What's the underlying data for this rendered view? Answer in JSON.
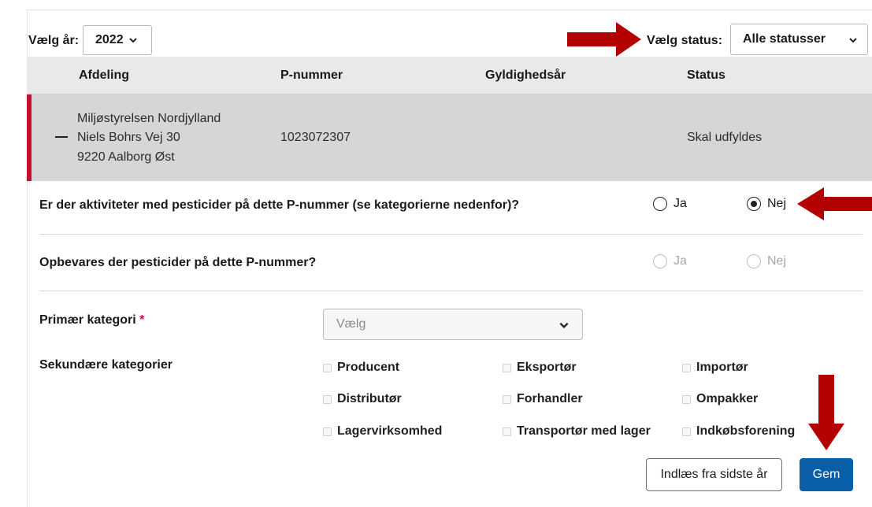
{
  "filters": {
    "year_label": "Vælg år:",
    "year_value": "2022",
    "status_label": "Vælg status:",
    "status_value": "Alle statusser"
  },
  "table": {
    "headers": [
      "Afdeling",
      "P-nummer",
      "Gyldighedsår",
      "Status"
    ],
    "row": {
      "dept_line1": "Miljøstyrelsen Nordjylland",
      "dept_line2": "Niels Bohrs Vej 30",
      "dept_line3": "9220 Aalborg Øst",
      "p_number": "1023072307",
      "validity_year": "",
      "status": "Skal udfyldes"
    }
  },
  "form": {
    "q1": {
      "text": "Er der aktiviteter med pesticider på dette P-nummer (se kategorierne nedenfor)?",
      "yes": "Ja",
      "no": "Nej",
      "selected": "Nej"
    },
    "q2": {
      "text": "Opbevares der pesticider på dette P-nummer?",
      "yes": "Ja",
      "no": "Nej",
      "disabled": true
    },
    "primary_label": "Primær kategori",
    "required_mark": "*",
    "primary_placeholder": "Vælg",
    "secondary_label": "Sekundære kategorier",
    "secondary_options": [
      "Producent",
      "Eksportør",
      "Importør",
      "Distributør",
      "Forhandler",
      "Ompakker",
      "Lagervirksomhed",
      "Transportør med lager",
      "Indkøbsforening"
    ]
  },
  "buttons": {
    "load_last_year": "Indlæs fra sidste år",
    "save": "Gem"
  },
  "colors": {
    "accent_red": "#c8102e",
    "arrow_red": "#b30000",
    "primary_blue": "#0b5ea8",
    "header_bg": "#e9e9e9",
    "row_bg": "#d6d6d6"
  }
}
